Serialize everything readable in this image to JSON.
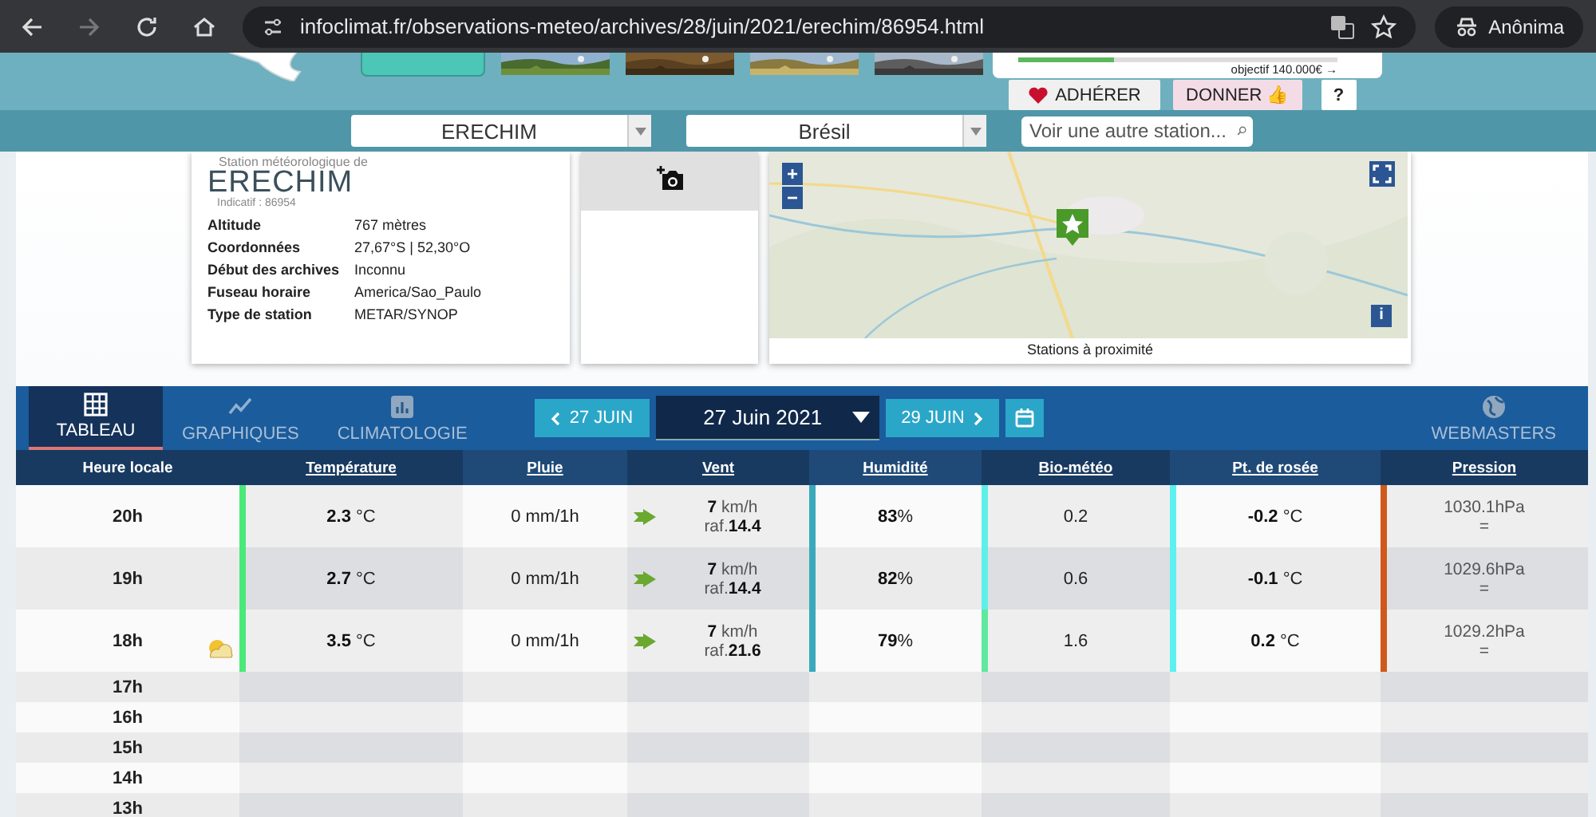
{
  "browser": {
    "url": "infoclimat.fr/observations-meteo/archives/28/juin/2021/erechim/86954.html",
    "profile": "Anônima"
  },
  "header": {
    "donation": {
      "level": 0.3,
      "goal": "objectif 140.000€ →"
    },
    "buttons": [
      {
        "kind": "heart",
        "label": "ADHÉRER"
      },
      {
        "kind": "thumb",
        "label": "DONNER 👍"
      },
      {
        "kind": "help",
        "label": "?"
      }
    ]
  },
  "selectors": {
    "station": "ERECHIM",
    "country": "Brésil",
    "search": {
      "placeholder": "Voir une autre station..."
    }
  },
  "station": {
    "subtitle": "Station météorologique de",
    "name": "ERECHIM",
    "code": "Indicatif : 86954",
    "details": [
      {
        "label": "Altitude",
        "value": "767 mètres"
      },
      {
        "label": "Coordonnées",
        "value": "27,67°S | 52,30°O"
      },
      {
        "label": "Début des archives",
        "value": "Inconnu"
      },
      {
        "label": "Fuseau horaire",
        "value": "America/Sao_Paulo"
      },
      {
        "label": "Type de station",
        "value": "METAR/SYNOP"
      }
    ]
  },
  "map": {
    "caption": "Stations à proximité",
    "zoom_in": "+",
    "zoom_out": "−",
    "info": "i"
  },
  "tabs": [
    {
      "label": "TABLEAU",
      "selected": true
    },
    {
      "label": "GRAPHIQUES",
      "selected": false
    },
    {
      "label": "CLIMATOLOGIE",
      "selected": false
    }
  ],
  "date_nav": {
    "prev": "27 JUIN",
    "current": "27 Juin 2021",
    "next": "29 JUIN"
  },
  "webmasters": "WEBMASTERS",
  "table": {
    "columns": [
      "Heure locale",
      "Température",
      "Pluie",
      "Vent",
      "Humidité",
      "Bio-météo",
      "Pt. de rosée",
      "Pression"
    ],
    "rows": [
      {
        "hour": "20h",
        "weather_icon": false,
        "temperature": {
          "text": "**2.3** °C",
          "color": "#4be87a"
        },
        "rain": "0 mm/1h",
        "wind": "**7** km/h",
        "gust": "raf.**14.4**",
        "humidity": {
          "text": "**83**%",
          "color": "#3aaabb"
        },
        "bio": {
          "text": "0.2",
          "color": "#5ef0e8"
        },
        "dew": {
          "text": "**-0.2** °C",
          "color": "#5ef0f0"
        },
        "pressure": {
          "text": "1030.1hPa",
          "trend": "=",
          "color": "#d0581c"
        }
      },
      {
        "hour": "19h",
        "weather_icon": false,
        "temperature": {
          "text": "**2.7** °C",
          "color": "#4be87a"
        },
        "rain": "0 mm/1h",
        "wind": "**7** km/h",
        "gust": "raf.**14.4**",
        "humidity": {
          "text": "**82**%",
          "color": "#3aaabb"
        },
        "bio": {
          "text": "0.6",
          "color": "#5ef0e8"
        },
        "dew": {
          "text": "**-0.1** °C",
          "color": "#5ef0f0"
        },
        "pressure": {
          "text": "1029.6hPa",
          "trend": "=",
          "color": "#d0581c"
        }
      },
      {
        "hour": "18h",
        "weather_icon": true,
        "temperature": {
          "text": "**3.5** °C",
          "color": "#4be87a"
        },
        "rain": "0 mm/1h",
        "wind": "**7** km/h",
        "gust": "raf.**21.6**",
        "humidity": {
          "text": "**79**%",
          "color": "#3aaabb"
        },
        "bio": {
          "text": "1.6",
          "color": "#5ee8a0"
        },
        "dew": {
          "text": "**0.2** °C",
          "color": "#5ef0f0"
        },
        "pressure": {
          "text": "1029.2hPa",
          "trend": "=",
          "color": "#d0581c"
        }
      }
    ],
    "empty_hours": [
      "17h",
      "16h",
      "15h",
      "14h",
      "13h"
    ]
  }
}
